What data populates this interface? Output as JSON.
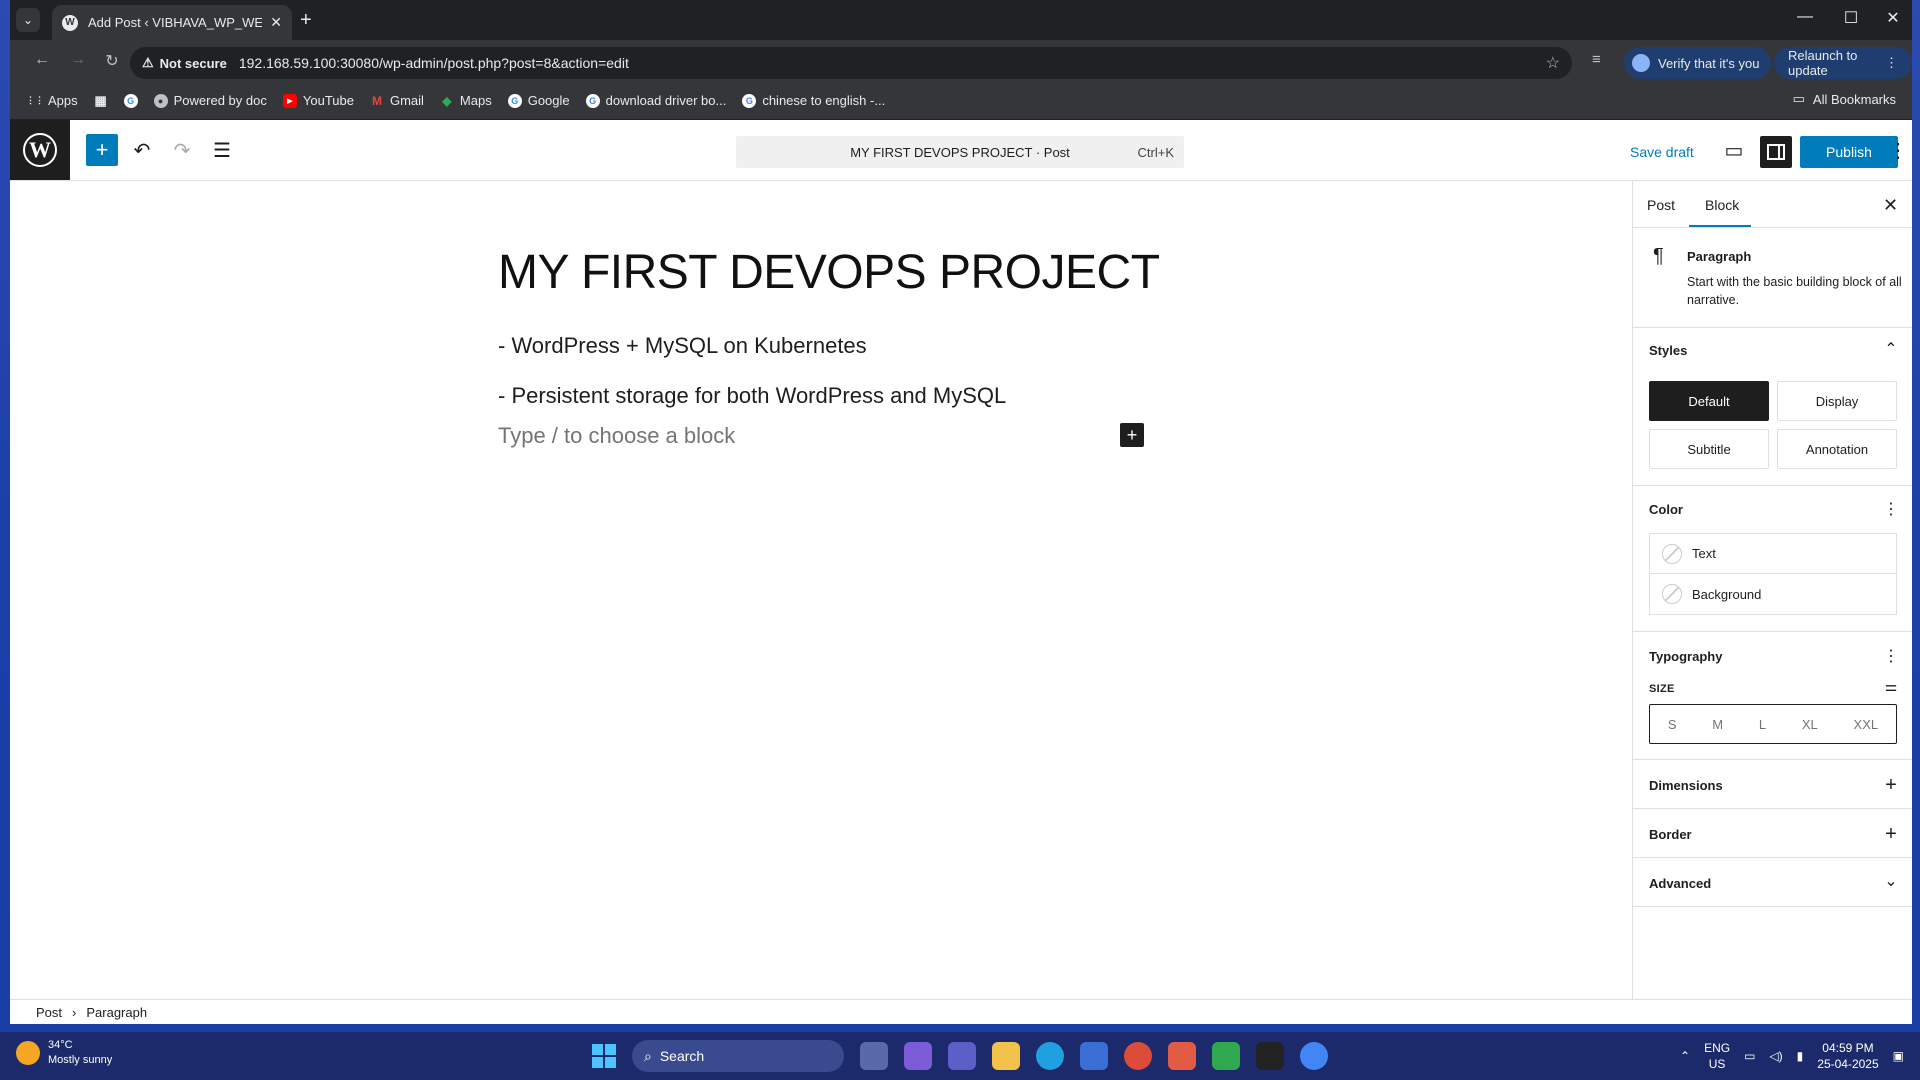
{
  "browser": {
    "tab_title": "Add Post ‹ VIBHAVA_WP_WEBSI",
    "security_label": "Not secure",
    "url": "192.168.59.100:30080/wp-admin/post.php?post=8&action=edit",
    "verify_label": "Verify that it's you",
    "relaunch_label": "Relaunch to update",
    "bookmarks": [
      "Apps",
      "Powered by doc",
      "YouTube",
      "Gmail",
      "Maps",
      "Google",
      "download driver bo...",
      "chinese to english -..."
    ],
    "all_bookmarks": "All Bookmarks"
  },
  "editor": {
    "command_title": "MY FIRST DEVOPS PROJECT · Post",
    "command_shortcut": "Ctrl+K",
    "save_draft": "Save draft",
    "publish": "Publish",
    "post_title": "MY FIRST DEVOPS PROJECT",
    "paragraphs": [
      "- WordPress + MySQL on Kubernetes",
      "- Persistent storage for both WordPress and MySQL"
    ],
    "placeholder": "Type / to choose a block"
  },
  "sidebar": {
    "tabs": [
      "Post",
      "Block"
    ],
    "active_tab": "Block",
    "block_name": "Paragraph",
    "block_description": "Start with the basic building block of all narrative.",
    "styles_title": "Styles",
    "styles": [
      "Default",
      "Display",
      "Subtitle",
      "Annotation"
    ],
    "active_style": "Default",
    "color_title": "Color",
    "color_items": [
      "Text",
      "Background"
    ],
    "typography_title": "Typography",
    "size_label": "SIZE",
    "sizes": [
      "S",
      "M",
      "L",
      "XL",
      "XXL"
    ],
    "dimensions_title": "Dimensions",
    "border_title": "Border",
    "advanced_title": "Advanced"
  },
  "footer": {
    "breadcrumb": [
      "Post",
      "Paragraph"
    ]
  },
  "taskbar": {
    "temperature": "34°C",
    "weather": "Mostly sunny",
    "search": "Search",
    "lang1": "ENG",
    "lang2": "US",
    "time": "04:59 PM",
    "date": "25-04-2025"
  },
  "colors": {
    "wp_blue": "#007cba",
    "wp_dark": "#1e1e1e",
    "chrome_dark": "#202124",
    "chrome_toolbar": "#35363a"
  }
}
